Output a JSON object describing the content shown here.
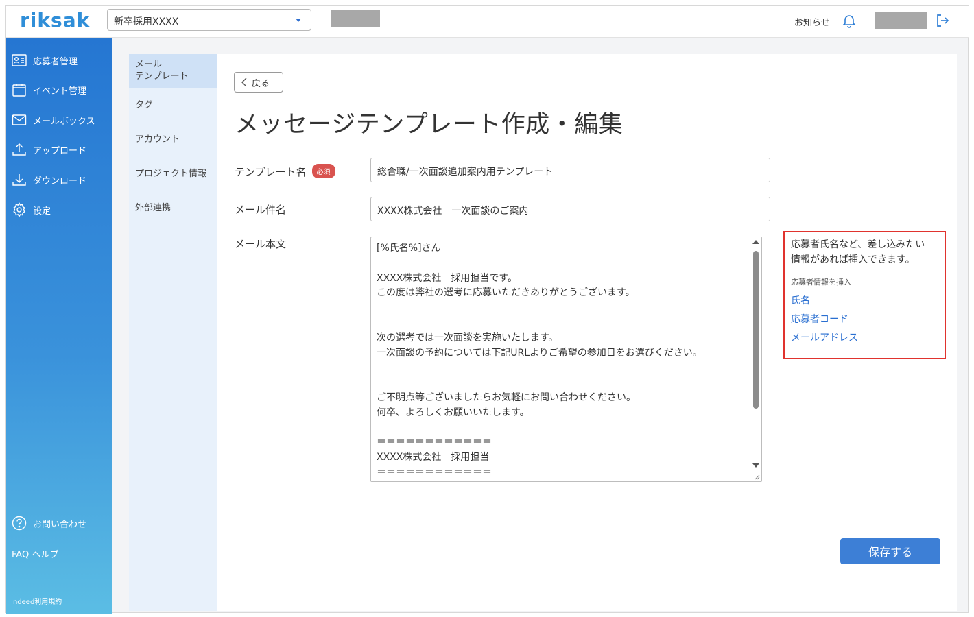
{
  "header": {
    "logo": "riksak",
    "project_select": "新卒採用XXXX",
    "notice_label": "お知らせ"
  },
  "sidebar": {
    "items": [
      {
        "label": "応募者管理",
        "icon": "applicant-card-icon"
      },
      {
        "label": "イベント管理",
        "icon": "calendar-icon"
      },
      {
        "label": "メールボックス",
        "icon": "mail-icon"
      },
      {
        "label": "アップロード",
        "icon": "upload-icon"
      },
      {
        "label": "ダウンロード",
        "icon": "download-icon"
      },
      {
        "label": "設定",
        "icon": "gear-icon"
      }
    ],
    "bottom_items": [
      {
        "label": "お問い合わせ",
        "icon": "question-circle-icon"
      },
      {
        "label": "FAQ ヘルプ"
      }
    ],
    "terms": "Indeed利用規約"
  },
  "subnav": {
    "items": [
      {
        "label": "メール\nテンプレート",
        "active": true
      },
      {
        "label": "タグ"
      },
      {
        "label": "アカウント"
      },
      {
        "label": "プロジェクト情報"
      },
      {
        "label": "外部連携"
      }
    ]
  },
  "main": {
    "back_label": "戻る",
    "title": "メッセージテンプレート作成・編集",
    "template_name_label": "テンプレート名",
    "required_badge": "必須",
    "template_name_value": "総合職/一次面談追加案内用テンプレート",
    "subject_label": "メール件名",
    "subject_value": "XXXX株式会社　一次面談のご案内",
    "body_label": "メール本文",
    "body_lines": [
      "[%氏名%]さん",
      "",
      "XXXX株式会社　採用担当です。",
      "この度は弊社の選考に応募いただきありがとうございます。",
      "",
      "",
      "次の選考では一次面談を実施いたします。",
      "一次面談の予約については下記URLよりご希望の参加日をお選びください。",
      "",
      "",
      "ご不明点等ございましたらお気軽にお問い合わせください。",
      "何卒、よろしくお願いいたします。",
      "",
      "＝＝＝＝＝＝＝＝＝＝＝＝",
      "XXXX株式会社　採用担当",
      "＝＝＝＝＝＝＝＝＝＝＝＝"
    ],
    "save_label": "保存する"
  },
  "help_box": {
    "text_line1": "応募者氏名など、差し込みたい",
    "text_line2": "情報があれば挿入できます。",
    "insert_title": "応募者情報を挿入",
    "links": [
      "氏名",
      "応募者コード",
      "メールアドレス"
    ]
  },
  "colors": {
    "accent": "#3d7fd6",
    "sidebar_top": "#2576d2",
    "sidebar_bottom": "#5bbde4",
    "required_badge": "#d9534f",
    "help_border": "#e0332e",
    "link": "#2a6fd1"
  }
}
